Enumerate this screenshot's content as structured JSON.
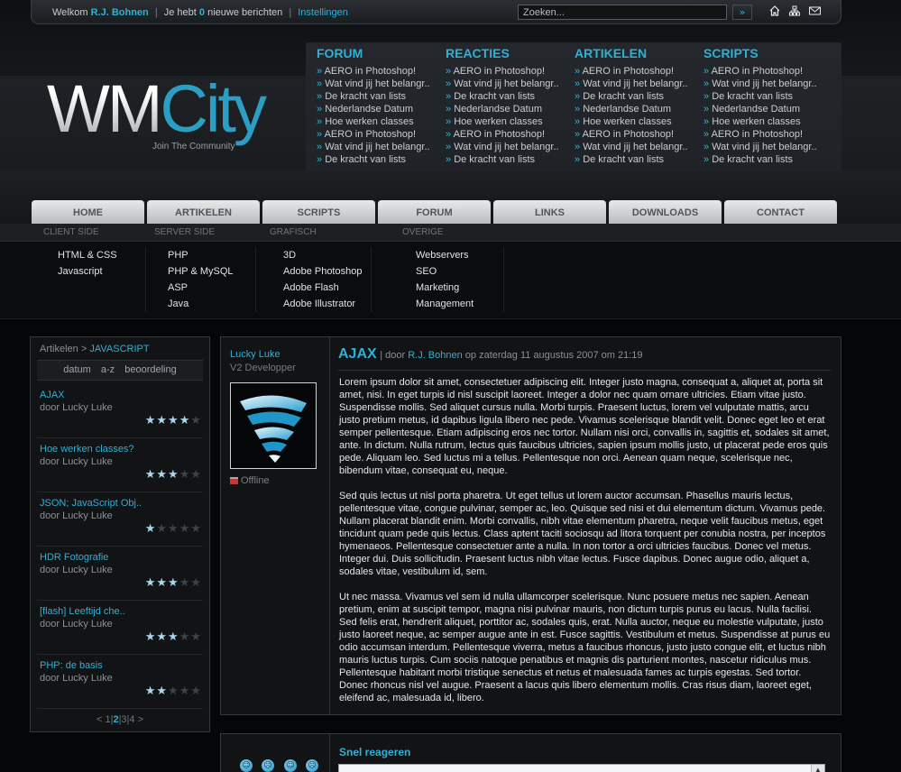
{
  "topbar": {
    "welcome_prefix": "Welkom",
    "username": "R.J. Bohnen",
    "separator": "|",
    "messages_prefix": "Je hebt",
    "message_count": "0",
    "messages_suffix": "nieuwe berichten",
    "settings_link": "Instellingen",
    "search_placeholder": "Zoeken...",
    "search_button": "»",
    "icons": [
      "home-icon",
      "sitemap-icon",
      "mail-icon"
    ]
  },
  "logo": {
    "part1": "WM",
    "part2": "City",
    "tagline": "Join The Community"
  },
  "quicklinks": [
    {
      "title": "FORUM",
      "items": [
        "AERO in Photoshop!",
        "Wat vind jij het belangr..",
        "De kracht van lists",
        "Nederlandse Datum",
        "Hoe werken classes",
        "AERO in Photoshop!",
        "Wat vind jij het belangr..",
        "De kracht van lists"
      ]
    },
    {
      "title": "REACTIES",
      "items": [
        "AERO in Photoshop!",
        "Wat vind jij het belangr..",
        "De kracht van lists",
        "Nederlandse Datum",
        "Hoe werken classes",
        "AERO in Photoshop!",
        "Wat vind jij het belangr..",
        "De kracht van lists"
      ]
    },
    {
      "title": "ARTIKELEN",
      "items": [
        "AERO in Photoshop!",
        "Wat vind jij het belangr..",
        "De kracht van lists",
        "Nederlandse Datum",
        "Hoe werken classes",
        "AERO in Photoshop!",
        "Wat vind jij het belangr..",
        "De kracht van lists"
      ]
    },
    {
      "title": "SCRIPTS",
      "items": [
        "AERO in Photoshop!",
        "Wat vind jij het belangr..",
        "De kracht van lists",
        "Nederlandse Datum",
        "Hoe werken classes",
        "AERO in Photoshop!",
        "Wat vind jij het belangr..",
        "De kracht van lists"
      ]
    }
  ],
  "nav": {
    "tabs": [
      "HOME",
      "ARTIKELEN",
      "SCRIPTS",
      "FORUM",
      "LINKS",
      "DOWNLOADS",
      "CONTACT"
    ],
    "subnav": [
      "CLIENT SIDE",
      "SERVER SIDE",
      "GRAFISCH",
      "OVERIGE"
    ],
    "mega": [
      [
        "HTML & CSS",
        "Javascript"
      ],
      [
        "PHP",
        "PHP & MySQL",
        "ASP",
        "Java"
      ],
      [
        "3D",
        "Adobe Photoshop",
        "Adobe Flash",
        "Adobe Illustrator"
      ],
      [
        "Webservers",
        "SEO",
        "Marketing",
        "Management"
      ]
    ]
  },
  "sidebar": {
    "crumb_parent": "Artikelen",
    "crumb_sep": ">",
    "crumb_current": "JAVASCRIPT",
    "sort": [
      "datum",
      "a-z",
      "beoordeling"
    ],
    "entries": [
      {
        "title": "AJAX",
        "author": "door Lucky Luke",
        "rating": 4
      },
      {
        "title": "Hoe werken classes?",
        "author": "door Lucky Luke",
        "rating": 3
      },
      {
        "title": "JSON; JavaScript Obj..",
        "author": "door Lucky Luke",
        "rating": 1
      },
      {
        "title": "HDR Fotografie",
        "author": "door Lucky Luke",
        "rating": 3
      },
      {
        "title": "[flash] Leeftijd che..",
        "author": "door Lucky Luke",
        "rating": 3
      },
      {
        "title": "PHP: de basis",
        "author": "door Lucky Luke",
        "rating": 2
      }
    ],
    "pager": {
      "prev": "<",
      "pages": [
        "1",
        "2",
        "3",
        "4"
      ],
      "active": "2",
      "next": ">",
      "sep": "|"
    }
  },
  "article": {
    "author": "Lucky Luke",
    "role": "V2 Developper",
    "status": "Offline",
    "title": "AJAX",
    "meta_pre": "| door",
    "meta_author": "R.J. Bohnen",
    "meta_date": "op zaterdag 11 augustus 2007 om 21:19",
    "paragraphs": [
      "Lorem ipsum dolor sit amet, consectetuer adipiscing elit. Integer justo magna, consequat a, aliquet at, porta sit amet, nisi. In eget turpis id nisl suscipit laoreet. Integer a dolor nec quam ornare ultricies. Etiam vitae justo. Suspendisse mollis. Sed aliquet cursus nulla. Morbi turpis. Praesent luctus, lorem vel vulputate mattis, arcu justo pretium metus, id dapibus ligula libero nec pede. Vivamus scelerisque blandit velit. Donec eget leo et erat semper pellentesque. Etiam adipiscing eros nec tortor. Nullam nisi orci, convallis in, sagittis et, sodales sit amet, ante. In dictum. Nulla rutrum, lectus quis faucibus ultricies, sapien ipsum mollis justo, ut placerat pede eros quis pede. Aliquam leo. Sed luctus mi a tellus. Pellentesque non orci. Aenean quam neque, scelerisque nec, bibendum vitae, consequat eu, neque.",
      "Sed quis lectus ut nisl porta pharetra. Ut eget tellus ut lorem auctor accumsan. Phasellus mauris lectus, pellentesque vitae, congue pulvinar, semper ac, leo. Quisque sed nisi et dui elementum dictum. Vivamus pede. Nullam placerat blandit enim. Morbi convallis, nibh vitae elementum pharetra, neque velit faucibus metus, eget tincidunt quam pede quis lectus. Class aptent taciti sociosqu ad litora torquent per conubia nostra, per inceptos hymenaeos. Pellentesque consectetuer ante a nulla. In non tortor a orci ultricies faucibus. Donec vel metus. Integer dui. Duis sollicitudin. Praesent luctus nibh vitae lectus. Fusce dapibus. Donec augue odio, aliquet a, sodales vitae, vestibulum id, sem.",
      "Ut nec massa. Vivamus vel sem id nulla ullamcorper scelerisque. Nunc posuere metus nec sapien. Aenean pretium, enim at suscipit tempor, magna nisi pulvinar mauris, non dictum turpis purus eu lacus. Nulla facilisi. Sed felis erat, hendrerit aliquet, porttitor ac, sodales quis, erat. Nulla auctor, neque eu molestie vulputate, justo justo laoreet neque, ac semper augue ante in est. Fusce sagittis. Vestibulum et metus. Suspendisse at purus eu odio accumsan interdum. Pellentesque viverra, metus a faucibus rhoncus, justo justo congue elit, et luctus nibh mauris luctus turpis. Cum sociis natoque penatibus et magnis dis parturient montes, nascetur ridiculus mus. Pellentesque habitant morbi tristique senectus et netus et malesuada fames ac turpis egestas. Sed tortor. Donec rhoncus nisl vel augue. Praesent a lacus quis libero elementum mollis. Cras risus diam, laoreet eget, eleifend ac, malesuada id, libero."
    ]
  },
  "reply": {
    "title": "Snel reageren",
    "smileys": [
      "smile",
      "frown",
      "smile",
      "frown"
    ]
  },
  "colors": {
    "accent": "#2fb1d6",
    "background": "#050607",
    "panel": "#111315"
  }
}
